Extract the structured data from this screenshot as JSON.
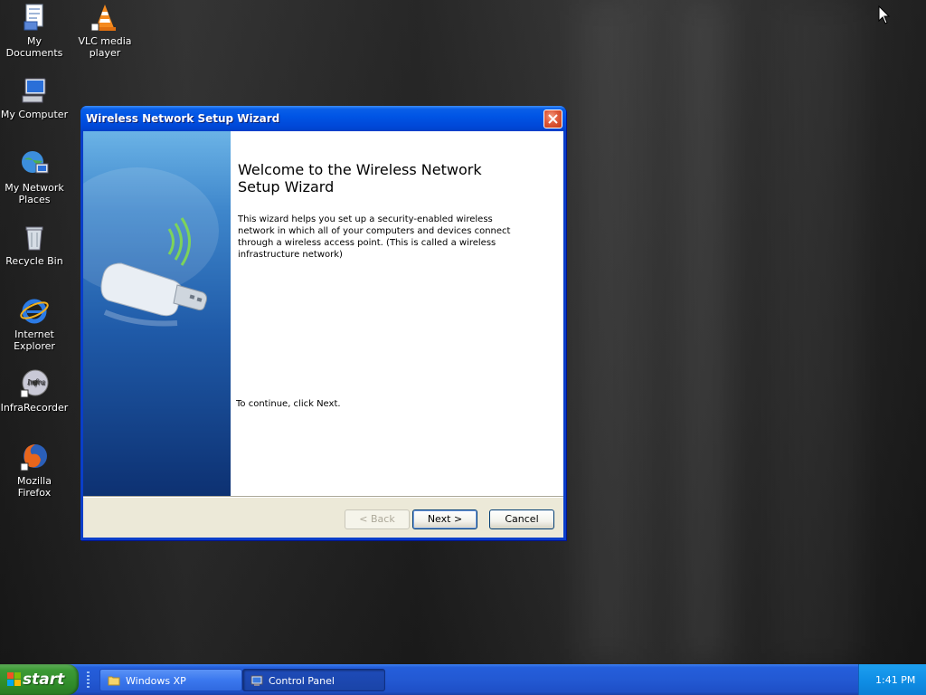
{
  "desktop": {
    "icons": [
      {
        "label": "My Documents",
        "icon": "documents-icon"
      },
      {
        "label": "VLC media player",
        "icon": "vlc-cone-icon"
      },
      {
        "label": "My Computer",
        "icon": "computer-icon"
      },
      {
        "label": "My Network Places",
        "icon": "network-places-icon"
      },
      {
        "label": "Recycle Bin",
        "icon": "recycle-bin-icon"
      },
      {
        "label": "Internet Explorer",
        "icon": "internet-explorer-icon"
      },
      {
        "label": "InfraRecorder",
        "icon": "infrarecorder-icon"
      },
      {
        "label": "Mozilla Firefox",
        "icon": "firefox-icon"
      }
    ]
  },
  "wizard": {
    "title": "Wireless Network Setup Wizard",
    "heading": "Welcome to the Wireless Network Setup Wizard",
    "intro": "This wizard helps you set up a security-enabled wireless network in which all of your computers and devices connect through a wireless access point. (This is called a wireless infrastructure network)",
    "continue": "To continue, click Next.",
    "buttons": {
      "back": "< Back",
      "next": "Next >",
      "cancel": "Cancel"
    },
    "side_image": "usb-wireless-adapter-icon"
  },
  "taskbar": {
    "start_label": "start",
    "tasks": [
      {
        "label": "Windows XP",
        "icon": "folder-icon"
      },
      {
        "label": "Control Panel",
        "icon": "control-panel-icon"
      }
    ],
    "clock": "1:41 PM"
  },
  "colors": {
    "title_bar": "#0055e5",
    "taskbar": "#245edb",
    "start_button": "#3c9a35",
    "dialog_face": "#ece9d8"
  }
}
